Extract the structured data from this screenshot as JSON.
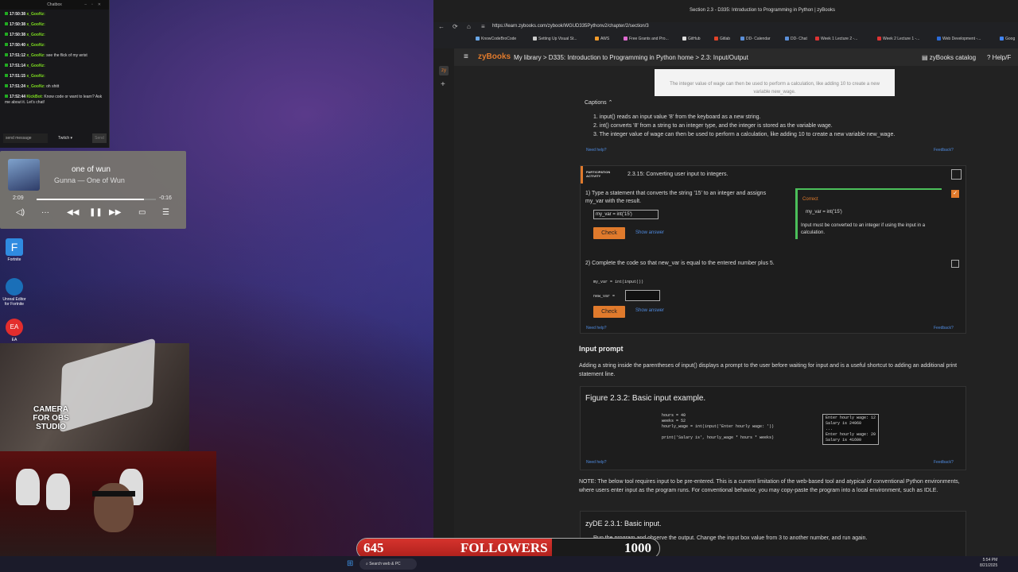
{
  "chatbox": {
    "title": "Chatbox",
    "lines": [
      {
        "time": "17:50:38",
        "user": "x_GooNz:",
        "msg": ""
      },
      {
        "time": "17:50:38",
        "user": "x_GooNz:",
        "msg": ""
      },
      {
        "time": "17:50:38",
        "user": "x_GooNz:",
        "msg": ""
      },
      {
        "time": "17:50:40",
        "user": "x_GooNz:",
        "msg": ""
      },
      {
        "time": "17:51:12",
        "user": "x_GooNz:",
        "msg": "see the flick of my wrist"
      },
      {
        "time": "17:51:14",
        "user": "x_GooNz:",
        "msg": ""
      },
      {
        "time": "17:51:15",
        "user": "x_GooNz:",
        "msg": ""
      },
      {
        "time": "17:51:24",
        "user": "x_GooNz:",
        "msg": "oh shitt"
      },
      {
        "time": "17:52:44",
        "user": "KickBot:",
        "msg": "Know code or want to learn? Ask me about it. Let's chat!"
      }
    ],
    "send_placeholder": "send message",
    "platform": "Twitch",
    "send_label": "Send"
  },
  "music": {
    "title": "one of wun",
    "artist": "Gunna — One of Wun",
    "elapsed": "2:09",
    "remaining": "-0:16",
    "progress": 0.9
  },
  "desktop_icons": [
    {
      "label": "Fortnite"
    },
    {
      "label": "Unreal Editor for Fortnite"
    },
    {
      "label": "EA"
    }
  ],
  "camera": {
    "label": "CAMERA FOR OBS STUDIO"
  },
  "browser": {
    "tab_title": "Section 2.3 - D335: Introduction to Programming in Python | zyBooks",
    "url": "https://learn.zybooks.com/zybook/WGUD335Pythonv2/chapter/2/section/3",
    "bookmarks": [
      "KnowCodeBroCode",
      "Setting Up Visual St...",
      "AWS",
      "Free Grants and Pro...",
      "GitHub",
      "Gitlab",
      "DD- Calendar",
      "DD- Chat",
      "Week 1 Lecture 2 -...",
      "Week 2 Lecture 1 -...",
      "Web Development -...",
      "Goog"
    ]
  },
  "zybooks": {
    "logo": "zyBooks",
    "breadcrumb": "My library > D335: Introduction to Programming in Python home > 2.3: Input/Output",
    "catalog": "zyBooks catalog",
    "help": "Help/F",
    "caption_top": "The integer value of wage can then be used to perform a calculation, like adding 10 to create a new variable new_wage.",
    "captions_label": "Captions",
    "captions": [
      "1. input() reads an input value '8' from the keyboard as a new string.",
      "2. int() converts '8' from a string to an integer type, and the integer is stored as the variable wage.",
      "3. The integer value of wage can then be used to perform a calculation, like adding 10 to create a new variable new_wage."
    ],
    "need_help": "Need help?",
    "feedback": "Feedback?",
    "activity_tag": "PARTICIPATION ACTIVITY",
    "activity_title": "2.3.15: Converting user input to integers.",
    "q1": "1)  Type a statement that converts the string '15' to an integer and assigns my_var with the result.",
    "q1_answer": "my_var = int('15')",
    "check": "Check",
    "show_answer": "Show answer",
    "correct_label": "Correct",
    "correct_code": "my_var = int('15')",
    "correct_explain": "Input must be converted to an integer if using the input in a calculation.",
    "q2": "2)  Complete the code so that new_var is equal to the entered number plus 5.",
    "q2_code1": "my_var = int(input())",
    "q2_code2": "new_var = ",
    "input_prompt_heading": "Input prompt",
    "input_prompt_text": "Adding a string inside the parentheses of input() displays a prompt to the user before waiting for input and is a useful shortcut to adding an additional print statement line.",
    "figure_title": "Figure 2.3.2: Basic input example.",
    "figure_code": "hours = 40\nweeks = 52\nhourly_wage = int(input('Enter hourly wage: '))\n\nprint('Salary is', hourly_wage * hours * weeks)",
    "figure_output": "Enter hourly wage: 12\nSalary is 24960\n...\nEnter hourly wage: 20\nSalary is 41600",
    "note": "NOTE: The below tool requires input to be pre-entered. This is a current limitation of the web-based tool and atypical of conventional Python environments, where users enter input as the program runs. For conventional behavior, you may copy-paste the program into a local environment, such as IDLE.",
    "zyde_title": "zyDE 2.3.1: Basic input.",
    "zyde_text": "Run the program and observe the output. Change the input box value from 3 to another number, and run again."
  },
  "followers": {
    "current": "645",
    "label": "FOLLOWERS",
    "goal": "1000",
    "progress": 0.645
  },
  "taskbar": {
    "search": "Search web & PC",
    "time": "5:54 PM",
    "date": "8/21/2025"
  }
}
